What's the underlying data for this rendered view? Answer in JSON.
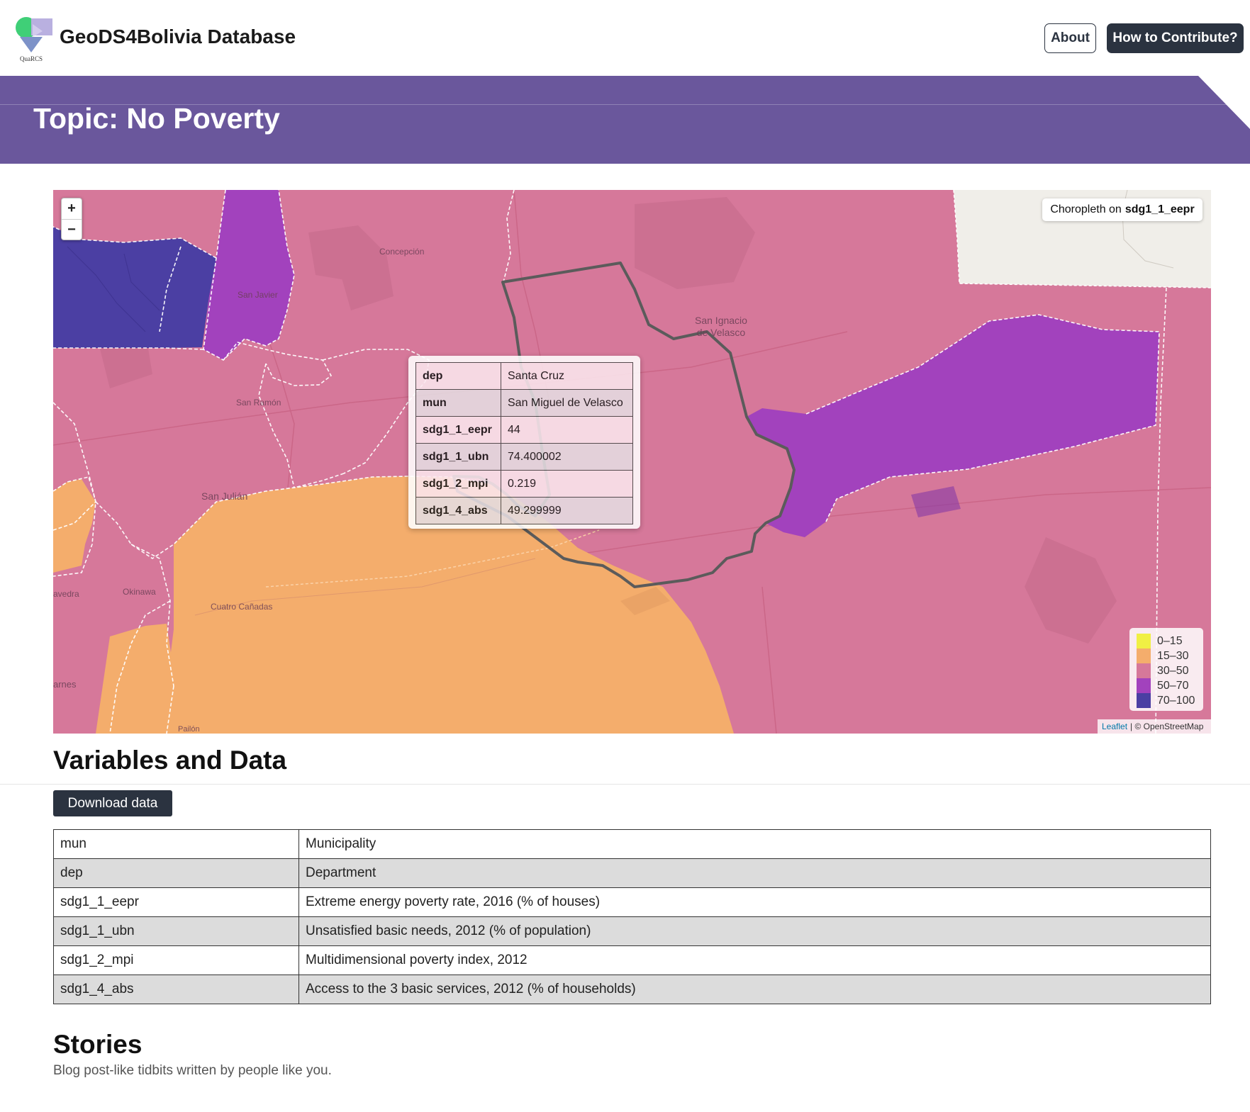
{
  "header": {
    "logo_caption": "QuaRCS",
    "title": "GeoDS4Bolivia Database",
    "about_label": "About",
    "contribute_label": "How to Contribute?"
  },
  "banner": {
    "title": "Topic: No Poverty"
  },
  "map": {
    "zoom_in": "+",
    "zoom_out": "−",
    "choropleth_prefix": "Choropleth on",
    "choropleth_variable": "sdg1_1_eepr",
    "places": {
      "concepcion": "Concepción",
      "san_javier": "San Javier",
      "san_ignacio": "San Ignacio",
      "san_ignacio_2": "de Velasco",
      "san_ramon": "San Ramón",
      "san_julian": "San Julián",
      "okinawa": "Okinawa",
      "cuatro_canadas": "Cuatro Cañadas",
      "saavedra": "avedra",
      "barnes": "arnes",
      "pailon": "Pailón"
    },
    "popup": [
      {
        "key": "dep",
        "value": "Santa Cruz"
      },
      {
        "key": "mun",
        "value": "San Miguel de Velasco"
      },
      {
        "key": "sdg1_1_eepr",
        "value": "44"
      },
      {
        "key": "sdg1_1_ubn",
        "value": "74.400002"
      },
      {
        "key": "sdg1_2_mpi",
        "value": "0.219"
      },
      {
        "key": "sdg1_4_abs",
        "value": "49.299999"
      }
    ],
    "legend": [
      {
        "label": "0–15",
        "color": "#f0f044"
      },
      {
        "label": "15–30",
        "color": "#f4ad6c"
      },
      {
        "label": "30–50",
        "color": "#d6789a"
      },
      {
        "label": "50–70",
        "color": "#a242bd"
      },
      {
        "label": "70–100",
        "color": "#4b3fa3"
      }
    ],
    "attribution_link": "Leaflet",
    "attribution_text": "| © OpenStreetMap"
  },
  "variables_section": {
    "title": "Variables and Data",
    "download_label": "Download data",
    "rows": [
      {
        "code": "mun",
        "description": "Municipality"
      },
      {
        "code": "dep",
        "description": "Department"
      },
      {
        "code": "sdg1_1_eepr",
        "description": "Extreme energy poverty rate, 2016 (% of houses)"
      },
      {
        "code": "sdg1_1_ubn",
        "description": "Unsatisfied basic needs, 2012 (% of population)"
      },
      {
        "code": "sdg1_2_mpi",
        "description": "Multidimensional poverty index, 2012"
      },
      {
        "code": "sdg1_4_abs",
        "description": "Access to the 3 basic services, 2012 (% of households)"
      }
    ]
  },
  "stories": {
    "title": "Stories",
    "subtitle": "Blog post-like tidbits written by people like you."
  }
}
